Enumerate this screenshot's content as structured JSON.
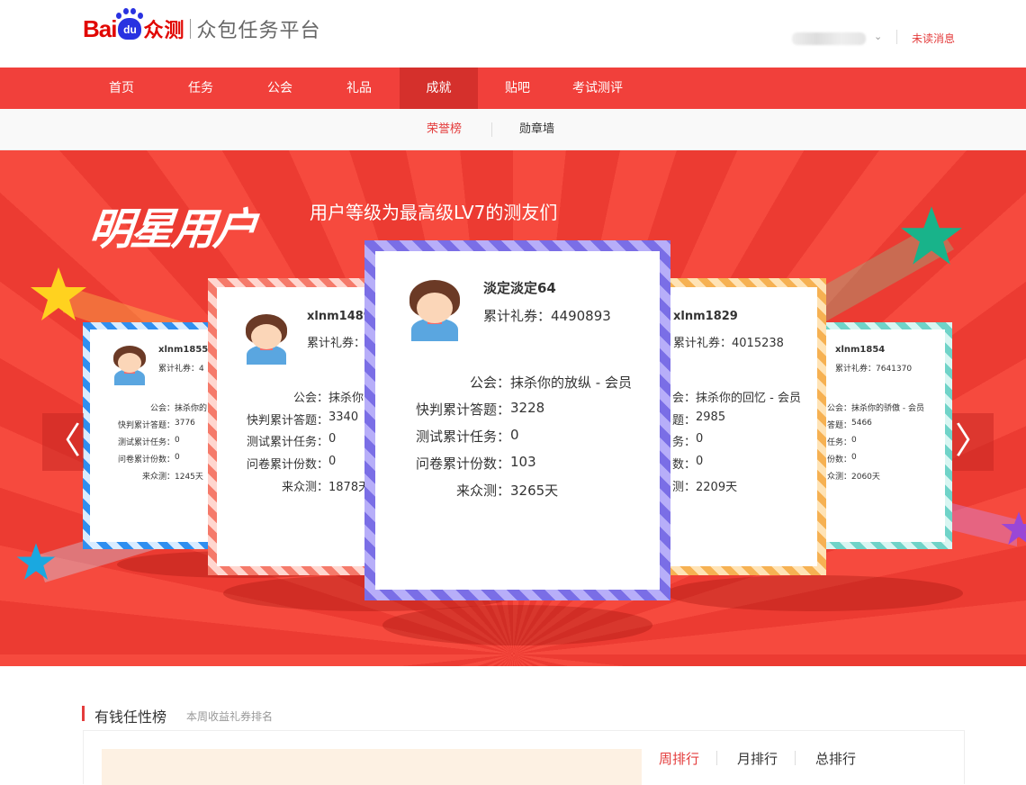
{
  "header": {
    "logo_bai": "Bai",
    "logo_du": "du",
    "logo_zc": "众测",
    "logo_sub": "众包任务平台",
    "unread_label": "未读消息",
    "caret": "⌄"
  },
  "nav": {
    "items": [
      {
        "label": "首页"
      },
      {
        "label": "任务"
      },
      {
        "label": "公会"
      },
      {
        "label": "礼品"
      },
      {
        "label": "成就"
      },
      {
        "label": "贴吧"
      },
      {
        "label": "考试测评"
      }
    ],
    "active_index": 4
  },
  "subnav": {
    "items": [
      {
        "label": "荣誉榜"
      },
      {
        "label": "勋章墙"
      }
    ],
    "active_index": 0
  },
  "banner": {
    "title": "明星用户",
    "subtitle": "用户等级为最高级LV7的测友们",
    "prev_arrow": "〈",
    "next_arrow": "〉",
    "cards": {
      "center": {
        "name": "淡定淡定64",
        "coupon": "累计礼券：4490893",
        "guild_label": "公会：",
        "guild_value": "抹杀你的放纵 - 会员",
        "quick_label": "快判累计答题：",
        "quick_value": "3228",
        "test_label": "测试累计任务：",
        "test_value": "0",
        "survey_label": "问卷累计份数：",
        "survey_value": "103",
        "days_label": "来众测：",
        "days_value": "3265天"
      },
      "left": {
        "name": "xlnm1489",
        "coupon": "累计礼券：",
        "guild_label": "公会：",
        "guild_value": "抹杀你",
        "quick_label": "快判累计答题：",
        "quick_value": "3340",
        "test_label": "测试累计任务：",
        "test_value": "0",
        "survey_label": "问卷累计份数：",
        "survey_value": "0",
        "days_label": "来众测：",
        "days_value": "1878天"
      },
      "right": {
        "name": "xlnm1829",
        "coupon": "累计礼券：4015238",
        "guild_label": "会：",
        "guild_value": "抹杀你的回忆 - 会员",
        "quick_label": "题：",
        "quick_value": "2985",
        "test_label": "务：",
        "test_value": "0",
        "survey_label": "数：",
        "survey_value": "0",
        "days_label": "测：",
        "days_value": "2209天"
      },
      "far_left": {
        "name": "xlnm1855",
        "coupon": "累计礼券：4",
        "guild_label": "公会：",
        "guild_value": "抹杀你的",
        "quick_label": "快判累计答题：",
        "quick_value": "3776",
        "test_label": "测试累计任务：",
        "test_value": "0",
        "survey_label": "问卷累计份数：",
        "survey_value": "0",
        "days_label": "来众测：",
        "days_value": "1245天"
      },
      "far_right": {
        "name": "xlnm1854",
        "coupon": "累计礼券：7641370",
        "guild_label": "公会：",
        "guild_value": "抹杀你的骄傲 - 会员",
        "quick_label": "答题：",
        "quick_value": "5466",
        "test_label": "任务：",
        "test_value": "0",
        "survey_label": "份数：",
        "survey_value": "0",
        "days_label": "众测：",
        "days_value": "2060天"
      }
    }
  },
  "ranking": {
    "title": "有钱任性榜",
    "subtitle": "本周收益礼券排名",
    "tabs": [
      {
        "label": "周排行"
      },
      {
        "label": "月排行"
      },
      {
        "label": "总排行"
      }
    ],
    "active_index": 0
  },
  "colors": {
    "brand_red": "#e10601",
    "nav_red": "#f1403b",
    "nav_active": "#d5302c",
    "accent": "#e43c3c",
    "baidu_blue": "#2932e1"
  }
}
